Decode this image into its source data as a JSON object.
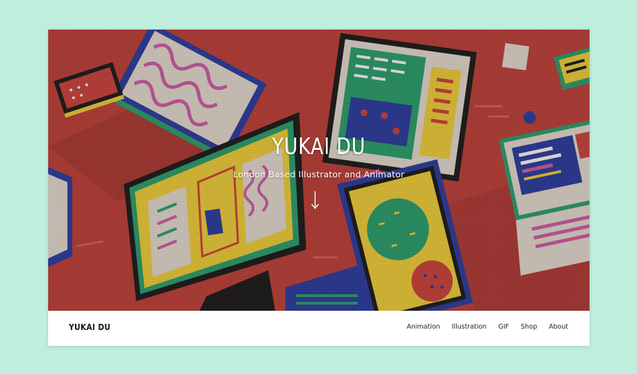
{
  "colors": {
    "page_background": "#bfeedd",
    "hero_background": "#b5403a",
    "hero_text": "#ffffff",
    "navbar_background": "#ffffff",
    "nav_text": "#222222"
  },
  "hero": {
    "title": "YUKAI DU",
    "subtitle": "London Based Illustrator and Animator",
    "scroll_icon": "arrow-down-icon",
    "illustration": "isometric-screens-illustration"
  },
  "navbar": {
    "brand": "YUKAI DU",
    "links": [
      {
        "label": "Animation"
      },
      {
        "label": "Illustration"
      },
      {
        "label": "GIF"
      },
      {
        "label": "Shop"
      },
      {
        "label": "About"
      }
    ]
  }
}
